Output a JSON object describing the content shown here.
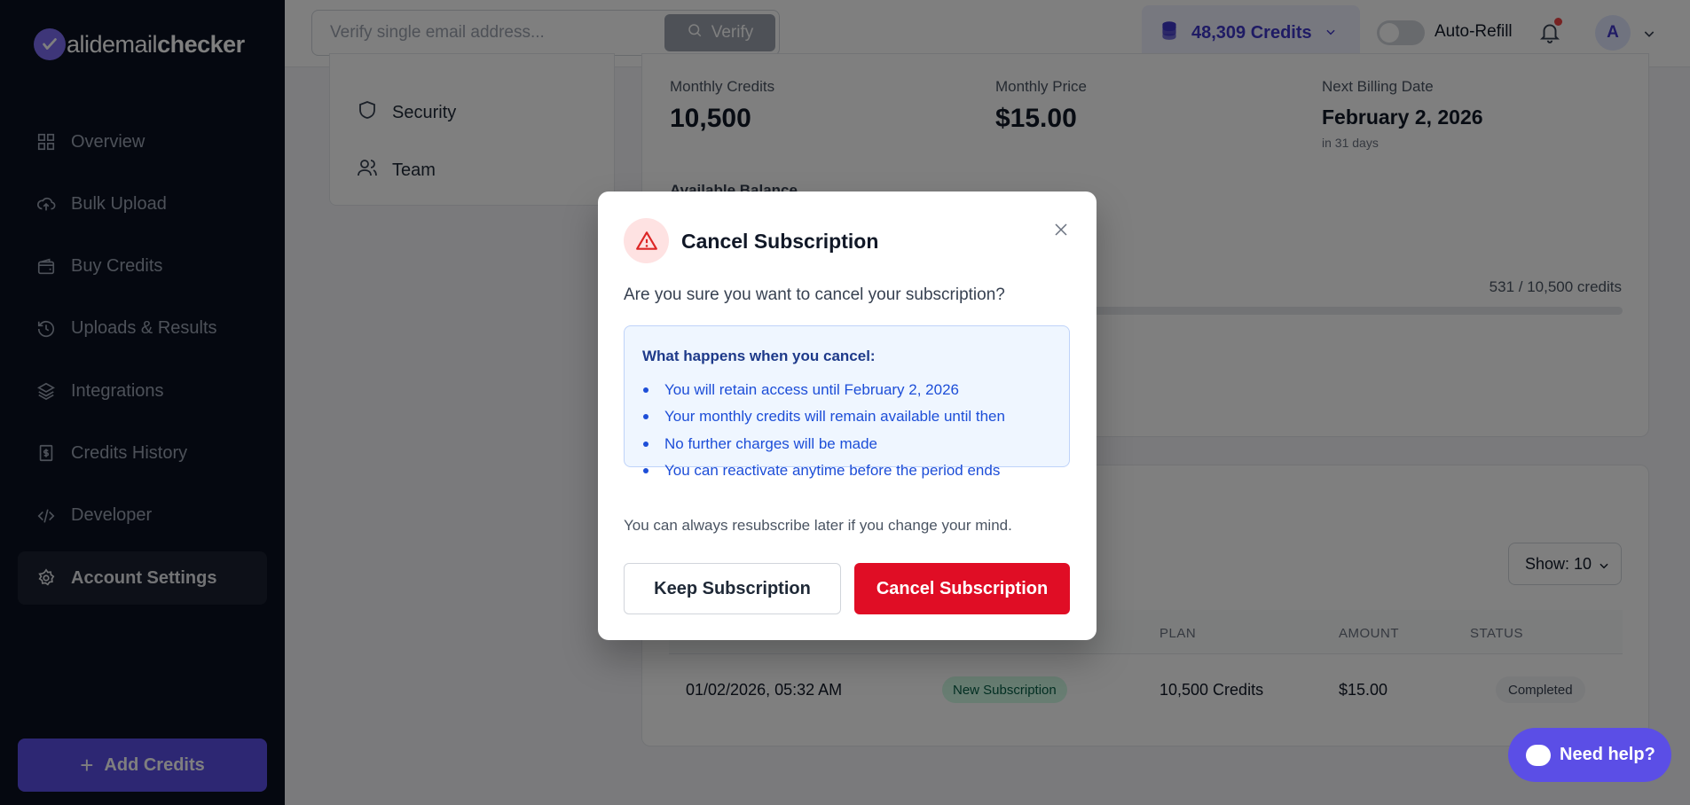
{
  "sidebar": {
    "logo_prefix": "v",
    "logo_light": "alidemail",
    "logo_bold": "checker",
    "items": [
      {
        "label": "Overview",
        "icon": "grid-icon"
      },
      {
        "label": "Bulk Upload",
        "icon": "cloud-upload-icon"
      },
      {
        "label": "Buy Credits",
        "icon": "wallet-icon"
      },
      {
        "label": "Uploads & Results",
        "icon": "history-icon"
      },
      {
        "label": "Integrations",
        "icon": "layers-icon"
      },
      {
        "label": "Credits History",
        "icon": "receipt-icon"
      },
      {
        "label": "Developer",
        "icon": "code-icon"
      },
      {
        "label": "Account Settings",
        "icon": "gear-icon",
        "active": true
      }
    ],
    "add_credits_label": "Add Credits"
  },
  "topbar": {
    "search_placeholder": "Verify single email address...",
    "verify_label": "Verify",
    "credits_label": "48,309 Credits",
    "autorefill_label": "Auto-Refill",
    "avatar_initial": "A"
  },
  "subnav": {
    "items": [
      {
        "label": "Security",
        "icon": "shield-icon"
      },
      {
        "label": "Team",
        "icon": "users-icon"
      }
    ]
  },
  "billing": {
    "monthly_credits_label": "Monthly Credits",
    "monthly_credits_value": "10,500",
    "monthly_price_label": "Monthly Price",
    "monthly_price_value": "$15.00",
    "next_billing_label": "Next Billing Date",
    "next_billing_value": "February 2, 2026",
    "next_billing_sub": "in 31 days",
    "available_balance_label": "Available Balance",
    "usage_text": "531 / 10,500 credits",
    "usage_fraction": 0.0506
  },
  "history": {
    "show_label": "Show: 10",
    "columns": [
      "PLAN",
      "AMOUNT",
      "STATUS"
    ],
    "rows": [
      {
        "date": "01/02/2026, 05:32 AM",
        "type": "New Subscription",
        "plan": "10,500 Credits",
        "amount": "$15.00",
        "status": "Completed"
      }
    ]
  },
  "modal": {
    "title": "Cancel Subscription",
    "question": "Are you sure you want to cancel your subscription?",
    "info_title": "What happens when you cancel:",
    "info_items": [
      "You will retain access until February 2, 2026",
      "Your monthly credits will remain available until then",
      "No further charges will be made",
      "You can reactivate anytime before the period ends"
    ],
    "note": "You can always resubscribe later if you change your mind.",
    "keep_label": "Keep Subscription",
    "cancel_label": "Cancel Subscription"
  },
  "help": {
    "label": "Need help?"
  },
  "colors": {
    "sidebar_bg": "#0b1120",
    "accent": "#5b4ee6",
    "danger": "#e00d25",
    "info_bg": "#eff6ff"
  }
}
